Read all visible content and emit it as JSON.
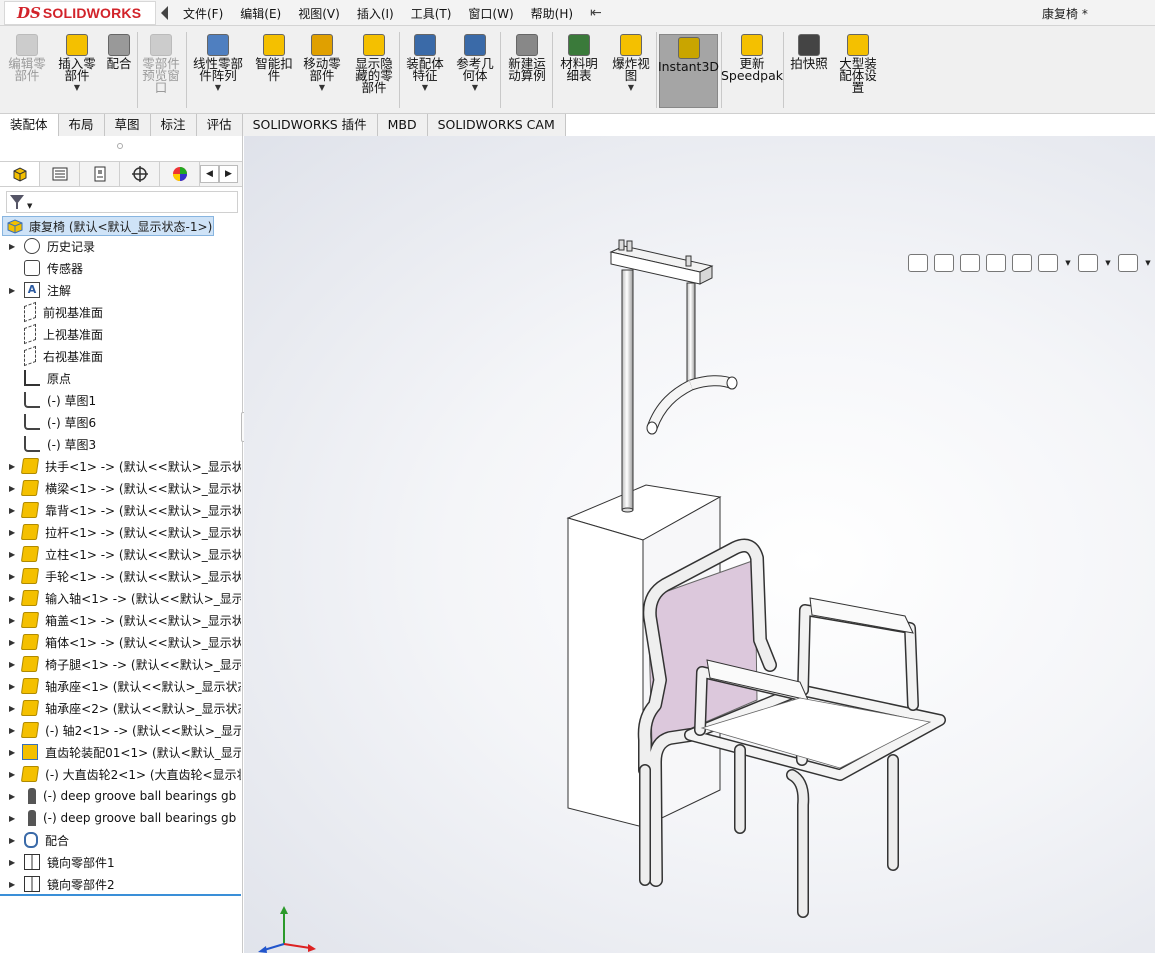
{
  "app": {
    "logo_prefix": "DS",
    "logo_text": "SOLIDWORKS",
    "document_title": "康复椅 *"
  },
  "menu": {
    "items": [
      "文件(F)",
      "编辑(E)",
      "视图(V)",
      "插入(I)",
      "工具(T)",
      "窗口(W)",
      "帮助(H)"
    ],
    "pin": "⇤"
  },
  "ribbon": {
    "buttons": [
      {
        "label": "编辑零\n部件",
        "icon": "edit-component-icon",
        "enabled": false
      },
      {
        "label": "插入零\n部件",
        "icon": "insert-component-icon",
        "enabled": true,
        "dropdown": true
      },
      {
        "label": "配合",
        "icon": "mate-icon",
        "enabled": true
      },
      {
        "label": "零部件\n预览窗\n口",
        "icon": "component-preview-icon",
        "enabled": false
      },
      {
        "label": "线性零部\n件阵列",
        "icon": "linear-pattern-icon",
        "enabled": true,
        "dropdown": true
      },
      {
        "label": "智能扣\n件",
        "icon": "smart-fastener-icon",
        "enabled": true
      },
      {
        "label": "移动零\n部件",
        "icon": "move-component-icon",
        "enabled": true,
        "dropdown": true
      },
      {
        "label": "显示隐\n藏的零\n部件",
        "icon": "show-hidden-icon",
        "enabled": true
      },
      {
        "label": "装配体\n特征",
        "icon": "assembly-feature-icon",
        "enabled": true,
        "dropdown": true
      },
      {
        "label": "参考几\n何体",
        "icon": "reference-geometry-icon",
        "enabled": true,
        "dropdown": true
      },
      {
        "label": "新建运\n动算例",
        "icon": "motion-study-icon",
        "enabled": true
      },
      {
        "label": "材料明\n细表",
        "icon": "bom-icon",
        "enabled": true
      },
      {
        "label": "爆炸视\n图",
        "icon": "exploded-view-icon",
        "enabled": true,
        "dropdown": true
      },
      {
        "label": "Instant3D",
        "icon": "instant3d-icon",
        "enabled": true,
        "active": true
      },
      {
        "label": "更新\nSpeedpak",
        "icon": "speedpak-icon",
        "enabled": true
      },
      {
        "label": "拍快照",
        "icon": "snapshot-icon",
        "enabled": true
      },
      {
        "label": "大型装\n配体设\n置",
        "icon": "large-assembly-icon",
        "enabled": true
      }
    ]
  },
  "tabs": [
    "装配体",
    "布局",
    "草图",
    "标注",
    "评估",
    "SOLIDWORKS 插件",
    "MBD",
    "SOLIDWORKS CAM"
  ],
  "feature_tree": {
    "root": "康复椅  (默认<默认_显示状态-1>)",
    "items": [
      {
        "label": "历史记录",
        "icon": "history-icon",
        "expandable": true
      },
      {
        "label": "传感器",
        "icon": "sensor-icon",
        "expandable": false
      },
      {
        "label": "注解",
        "icon": "annotations-icon",
        "expandable": true
      },
      {
        "label": "前视基准面",
        "icon": "plane-icon",
        "expandable": false
      },
      {
        "label": "上视基准面",
        "icon": "plane-icon",
        "expandable": false
      },
      {
        "label": "右视基准面",
        "icon": "plane-icon",
        "expandable": false
      },
      {
        "label": "原点",
        "icon": "origin-icon",
        "expandable": false
      },
      {
        "label": "(-) 草图1",
        "icon": "sketch-icon",
        "expandable": false
      },
      {
        "label": "(-) 草图6",
        "icon": "sketch-icon",
        "expandable": false
      },
      {
        "label": "(-) 草图3",
        "icon": "sketch-icon",
        "expandable": false
      },
      {
        "label": "扶手<1> -> (默认<<默认>_显示状",
        "icon": "part-icon",
        "expandable": true
      },
      {
        "label": "横梁<1> -> (默认<<默认>_显示状",
        "icon": "part-icon",
        "expandable": true
      },
      {
        "label": "靠背<1> -> (默认<<默认>_显示状",
        "icon": "part-icon",
        "expandable": true
      },
      {
        "label": "拉杆<1> -> (默认<<默认>_显示状",
        "icon": "part-icon",
        "expandable": true
      },
      {
        "label": "立柱<1> -> (默认<<默认>_显示状",
        "icon": "part-icon",
        "expandable": true
      },
      {
        "label": "手轮<1> -> (默认<<默认>_显示状",
        "icon": "part-icon",
        "expandable": true
      },
      {
        "label": "输入轴<1> -> (默认<<默认>_显示",
        "icon": "part-icon",
        "expandable": true
      },
      {
        "label": "箱盖<1> -> (默认<<默认>_显示状",
        "icon": "part-icon",
        "expandable": true
      },
      {
        "label": "箱体<1> -> (默认<<默认>_显示状",
        "icon": "part-icon",
        "expandable": true
      },
      {
        "label": "椅子腿<1> -> (默认<<默认>_显示",
        "icon": "part-icon",
        "expandable": true
      },
      {
        "label": "轴承座<1> (默认<<默认>_显示状态",
        "icon": "part-icon",
        "expandable": true
      },
      {
        "label": "轴承座<2> (默认<<默认>_显示状态",
        "icon": "part-icon",
        "expandable": true
      },
      {
        "label": "(-) 轴2<1> -> (默认<<默认>_显示",
        "icon": "part-icon",
        "expandable": true
      },
      {
        "label": "直齿轮装配01<1> (默认<默认_显示",
        "icon": "subassembly-icon",
        "expandable": true
      },
      {
        "label": "(-) 大直齿轮2<1> (大直齿轮<显示状",
        "icon": "part-icon",
        "expandable": true
      },
      {
        "label": "(-) deep groove ball bearings gb",
        "icon": "bolt-icon",
        "expandable": true
      },
      {
        "label": "(-) deep groove ball bearings gb",
        "icon": "bolt-icon",
        "expandable": true
      },
      {
        "label": "配合",
        "icon": "mates-icon",
        "expandable": true
      },
      {
        "label": "镜向零部件1",
        "icon": "mirror-component-icon",
        "expandable": true
      },
      {
        "label": "镜向零部件2",
        "icon": "mirror-component-icon",
        "expandable": true
      }
    ]
  },
  "panel_tabs": [
    "featuremanager-icon",
    "propertymanager-icon",
    "configurationmanager-icon",
    "dimxpert-icon",
    "displaymanager-icon"
  ],
  "heads_up_toolbar": [
    "zoom-to-fit-icon",
    "zoom-area-icon",
    "previous-view-icon",
    "section-view-icon",
    "dynamic-annotation-icon",
    "view-orientation-icon",
    "display-style-icon",
    "hide-show-icon"
  ],
  "colors": {
    "accent_blue": "#3a8fd8",
    "brand_red": "#d2232a",
    "part_yellow": "#f4c000",
    "backrest_mauve": "#d9c3d8"
  }
}
